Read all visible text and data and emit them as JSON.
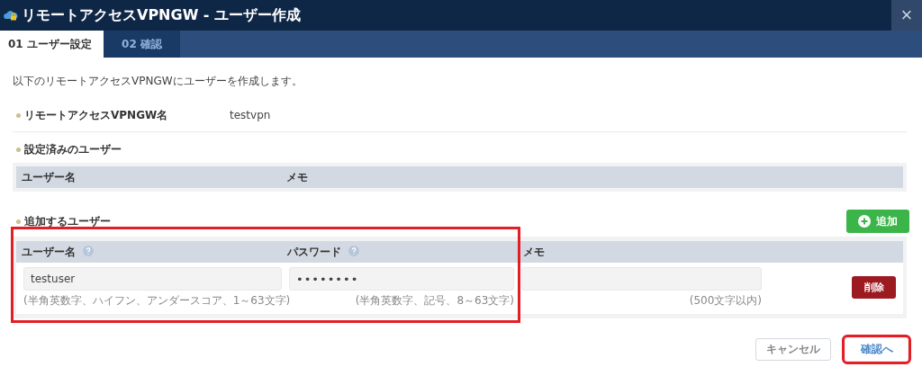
{
  "window": {
    "title": "リモートアクセスVPNGW - ユーザー作成",
    "close": "×"
  },
  "tabs": [
    {
      "label": "01 ユーザー設定",
      "selected": true
    },
    {
      "label": "02 確認",
      "selected": false
    }
  ],
  "intro": "以下のリモートアクセスVPNGWにユーザーを作成します。",
  "gateway": {
    "label": "リモートアクセスVPNGW名",
    "value": "testvpn"
  },
  "existing_users": {
    "heading": "設定済みのユーザー",
    "columns": [
      "ユーザー名",
      "メモ"
    ]
  },
  "new_users": {
    "heading": "追加するユーザー",
    "add_button": "追加",
    "columns": [
      {
        "label": "ユーザー名",
        "help": true
      },
      {
        "label": "パスワード",
        "help": true
      },
      {
        "label": "メモ",
        "help": false
      }
    ],
    "rows": [
      {
        "fields": [
          {
            "kind": "text",
            "value": "testuser",
            "hint": "(半角英数字、ハイフン、アンダースコア、1～63文字)"
          },
          {
            "kind": "password",
            "value": "••••••••",
            "hint": "(半角英数字、記号、8～63文字)"
          },
          {
            "kind": "text",
            "hint": "(500文字以内)"
          }
        ],
        "delete_button": "削除"
      }
    ]
  },
  "buttons": [
    {
      "label": "キャンセル",
      "kind": "secondary",
      "highlighted": false
    },
    {
      "label": "確認へ",
      "kind": "primary",
      "highlighted": true
    }
  ],
  "highlight_new_user_fields": true
}
